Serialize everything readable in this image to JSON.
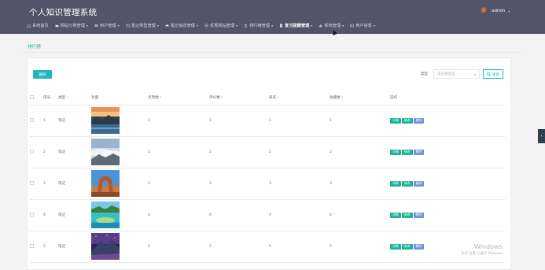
{
  "app": {
    "title": "个人知识管理系统"
  },
  "user": {
    "name": "admin"
  },
  "nav": [
    {
      "label": "系统首页",
      "icon": "home-icon",
      "caret": false,
      "active": false
    },
    {
      "label": "网站分类管理",
      "icon": "folder-icon",
      "caret": true,
      "active": false
    },
    {
      "label": "用户管理",
      "icon": "list-icon",
      "caret": true,
      "active": false
    },
    {
      "label": "笔记类型管理",
      "icon": "note-icon",
      "caret": true,
      "active": false
    },
    {
      "label": "笔记信息管理",
      "icon": "car-icon",
      "caret": true,
      "active": false
    },
    {
      "label": "优秀网站管理",
      "icon": "globe-icon",
      "caret": true,
      "active": false
    },
    {
      "label": "排行榜管理",
      "icon": "user-icon",
      "caret": true,
      "active": false
    },
    {
      "label": "复习提醒管理",
      "icon": "document-icon",
      "caret": true,
      "active": true
    },
    {
      "label": "系统管理",
      "icon": "bar-chart-icon",
      "caret": true,
      "active": false
    },
    {
      "label": "用户信息",
      "icon": "id-card-icon",
      "caret": true,
      "active": false
    }
  ],
  "breadcrumb": "排行榜",
  "toolbar": {
    "delete_label": "删除",
    "type_label": "类型",
    "type_placeholder": "请选择类型",
    "search_label": "查询"
  },
  "table": {
    "columns": [
      "序号",
      "类型",
      "封面",
      "点赞数",
      "评论数",
      "排名",
      "收藏数",
      "操作"
    ],
    "rows": [
      {
        "index": "1",
        "type": "笔记",
        "likes": "1",
        "comments": "1",
        "rank": "1",
        "favorites": "1",
        "cover": "sunset-lake-cover-icon"
      },
      {
        "index": "2",
        "type": "笔记",
        "likes": "2",
        "comments": "2",
        "rank": "2",
        "favorites": "2",
        "cover": "cloud-mountain-cover-icon"
      },
      {
        "index": "3",
        "type": "笔记",
        "likes": "3",
        "comments": "3",
        "rank": "3",
        "favorites": "3",
        "cover": "arch-rock-cover-icon"
      },
      {
        "index": "4",
        "type": "笔记",
        "likes": "4",
        "comments": "4",
        "rank": "4",
        "favorites": "4",
        "cover": "tropical-lagoon-cover-icon"
      },
      {
        "index": "5",
        "type": "笔记",
        "likes": "5",
        "comments": "5",
        "rank": "5",
        "favorites": "5",
        "cover": "starry-peak-cover-icon"
      }
    ],
    "actions": {
      "detail": "详情",
      "edit": "修改",
      "remove": "删除"
    }
  },
  "watermark": {
    "line1": "Windows",
    "line2": "转到\"设置\"以激活 Windows。"
  },
  "colors": {
    "topbar": "#505667",
    "accent": "#23b7c2",
    "green": "#1ab394",
    "blue": "#6d93d8"
  }
}
